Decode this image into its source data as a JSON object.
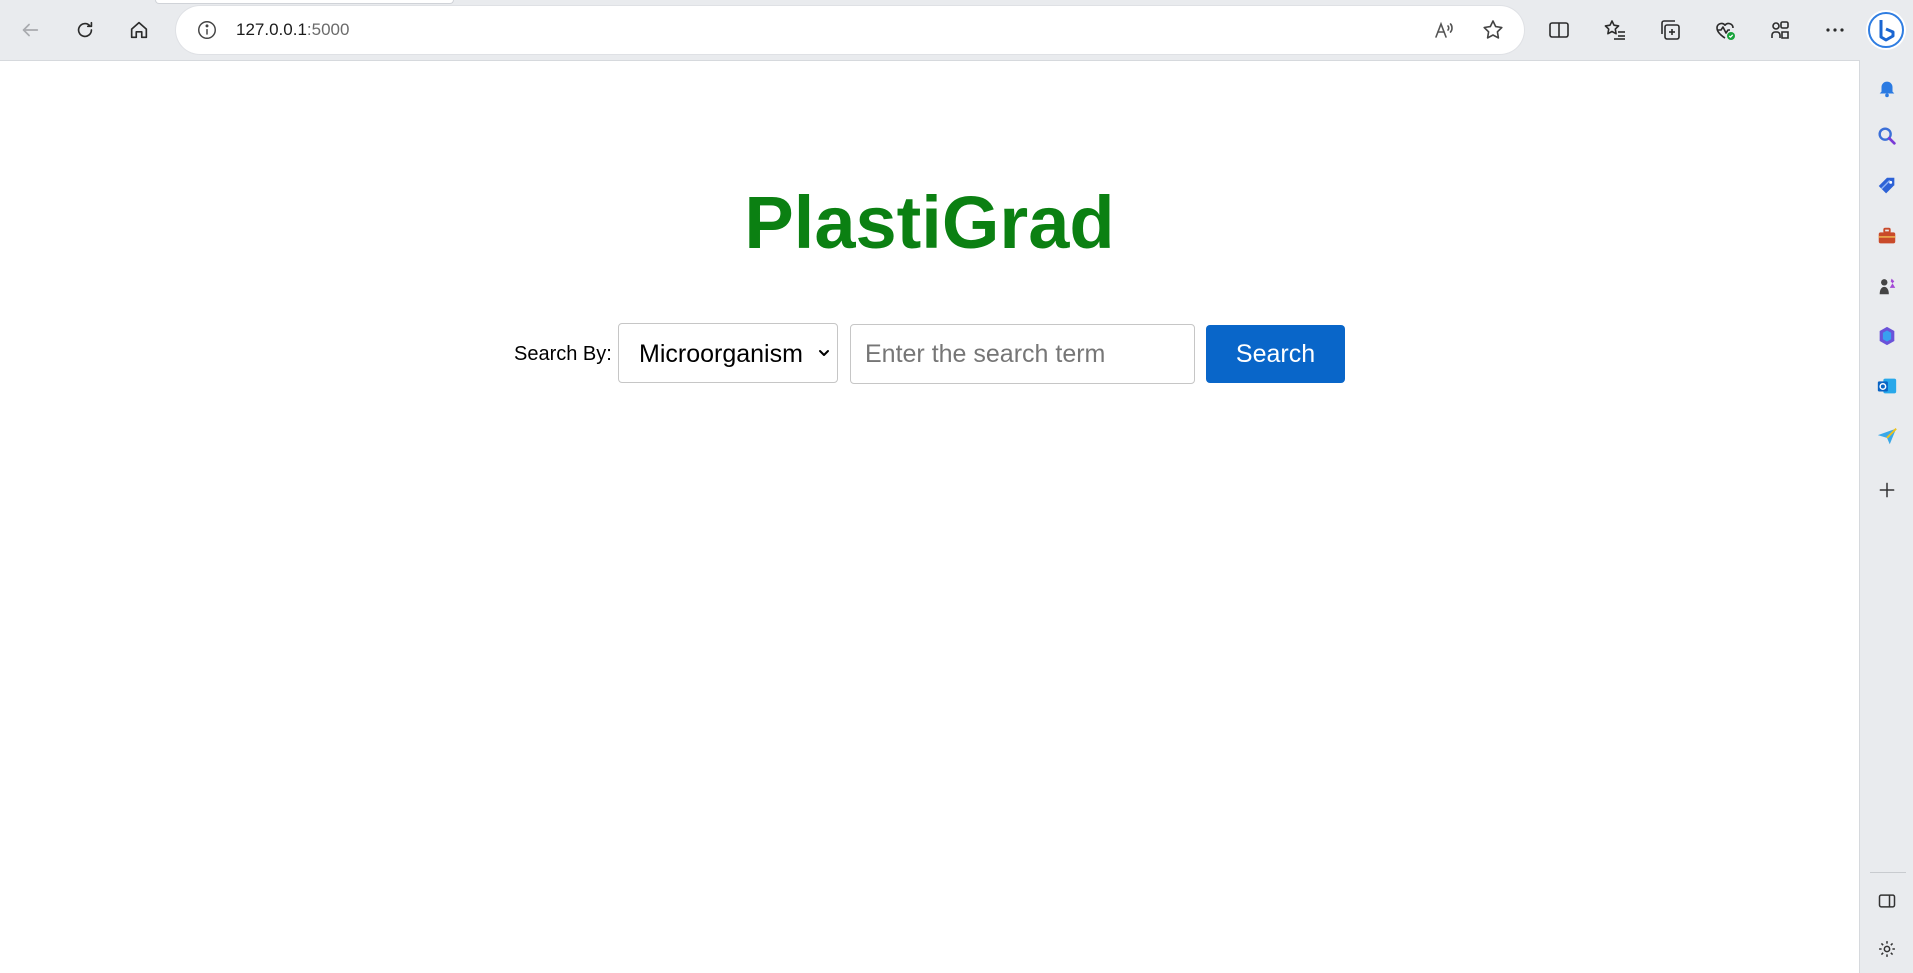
{
  "browser": {
    "address": {
      "host": "127.0.0.1",
      "port": ":5000"
    },
    "toolbar_icons": [
      "back-icon",
      "refresh-icon",
      "home-icon",
      "read-aloud-icon",
      "favorite-star-icon",
      "split-screen-icon",
      "favorites-icon",
      "collections-icon",
      "browser-essentials-icon",
      "extensions-icon",
      "more-icon",
      "bing-copilot-icon"
    ],
    "sidebar_icons": [
      "notifications-icon",
      "search-icon",
      "shopping-icon",
      "tools-icon",
      "games-icon",
      "microsoft-365-icon",
      "outlook-icon",
      "drop-icon",
      "add-icon",
      "hide-sidebar-icon",
      "settings-icon"
    ]
  },
  "page": {
    "title": "PlastiGrad",
    "search": {
      "label": "Search By:",
      "selected_option": "Microorganism",
      "input_placeholder": "Enter the search term",
      "button_label": "Search"
    }
  },
  "colors": {
    "title_green": "#0b8012",
    "button_blue": "#0966c9"
  }
}
